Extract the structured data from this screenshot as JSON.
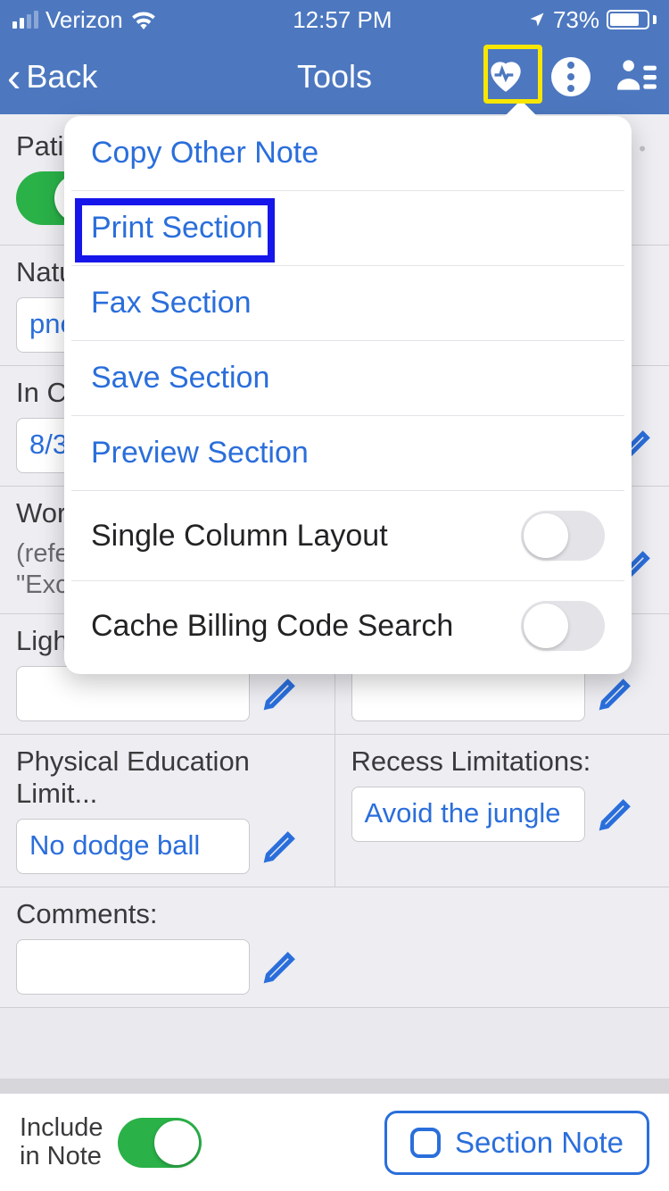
{
  "status": {
    "carrier": "Verizon",
    "time": "12:57 PM",
    "battery_pct": "73%"
  },
  "nav": {
    "back_label": "Back",
    "title": "Tools"
  },
  "popover": {
    "items": {
      "copy": "Copy Other Note",
      "print": "Print Section",
      "fax": "Fax Section",
      "save": "Save Section",
      "preview": "Preview Section",
      "single_col": "Single Column Layout",
      "cache": "Cache Billing Code Search"
    }
  },
  "form": {
    "patient_label": "Pati",
    "nature_label": "Natu",
    "nature_value": "pne",
    "inc_label": "In C",
    "inc_value": "8/3",
    "work_label": "Wor",
    "work_sub1": "(refe",
    "work_sub2": "\"Exc",
    "light_label": "Ligh",
    "pe_label": "Physical Education Limit...",
    "pe_value": "No dodge ball",
    "rec_label": "Recess Limitations:",
    "rec_value": "Avoid the jungle\ngym",
    "comments_label": "Comments:"
  },
  "footer": {
    "include_label": "Include\nin Note",
    "section_btn": "Section Note"
  }
}
